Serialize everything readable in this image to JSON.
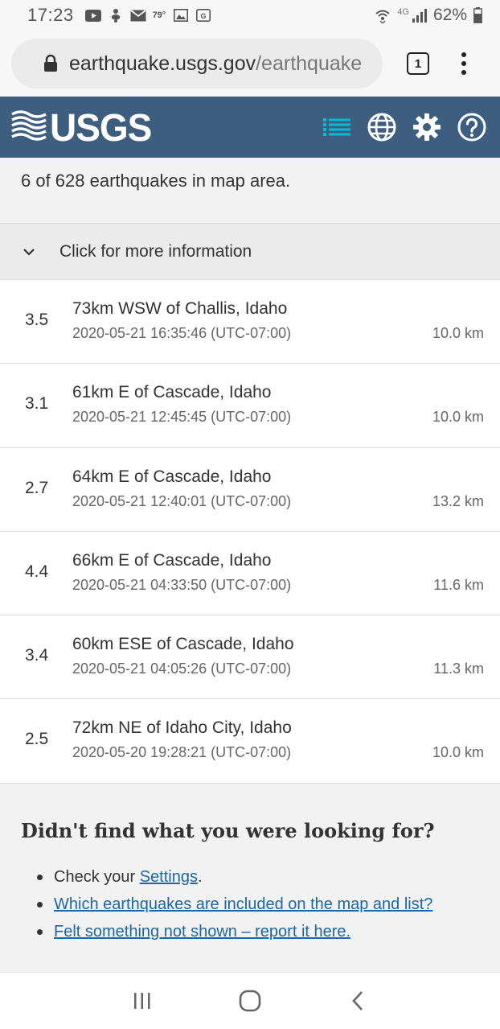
{
  "status_bar": {
    "time": "17:23",
    "temperature": "79°",
    "network": "4G",
    "battery": "62%"
  },
  "browser": {
    "url_main": "earthquake.usgs.gov",
    "url_path": "/earthquake",
    "tab_count": "1"
  },
  "header": {
    "logo_text": "USGS",
    "accent_color": "#00bcd4",
    "background_color": "#3e5e80"
  },
  "summary": {
    "count_text": "6 of 628 earthquakes in map area."
  },
  "info_toggle": {
    "label": "Click for more information"
  },
  "earthquakes": [
    {
      "magnitude": "3.5",
      "place": "73km WSW of Challis, Idaho",
      "time": "2020-05-21 16:35:46 (UTC-07:00)",
      "depth": "10.0 km"
    },
    {
      "magnitude": "3.1",
      "place": "61km E of Cascade, Idaho",
      "time": "2020-05-21 12:45:45 (UTC-07:00)",
      "depth": "10.0 km"
    },
    {
      "magnitude": "2.7",
      "place": "64km E of Cascade, Idaho",
      "time": "2020-05-21 12:40:01 (UTC-07:00)",
      "depth": "13.2 km"
    },
    {
      "magnitude": "4.4",
      "place": "66km E of Cascade, Idaho",
      "time": "2020-05-21 04:33:50 (UTC-07:00)",
      "depth": "11.6 km"
    },
    {
      "magnitude": "3.4",
      "place": "60km ESE of Cascade, Idaho",
      "time": "2020-05-21 04:05:26 (UTC-07:00)",
      "depth": "11.3 km"
    },
    {
      "magnitude": "2.5",
      "place": "72km NE of Idaho City, Idaho",
      "time": "2020-05-20 19:28:21 (UTC-07:00)",
      "depth": "10.0 km"
    }
  ],
  "help": {
    "title": "Didn't find what you were looking for?",
    "item1_prefix": "Check your ",
    "item1_link": "Settings",
    "item1_suffix": ".",
    "item2_link": "Which earthquakes are included on the map and list?",
    "item3_link": "Felt something not shown – report it here."
  },
  "icons": {
    "list": "list-icon",
    "map": "globe-icon",
    "settings": "gear-icon",
    "help": "help-icon"
  }
}
